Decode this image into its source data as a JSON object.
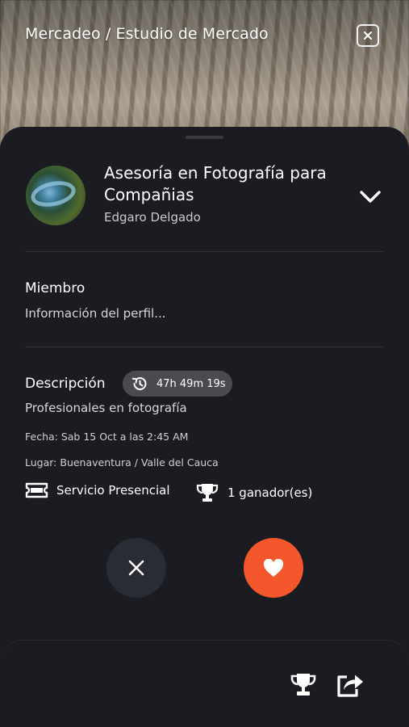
{
  "header": {
    "title": "Mercadeo / Estudio de Mercado",
    "close_icon": "close-icon"
  },
  "event": {
    "title": "Asesoría en Fotografía para Compañias",
    "owner": "Edgaro Delgado",
    "expand_icon": "chevron-down-icon"
  },
  "member": {
    "heading": "Miembro",
    "text": "Información del perfil..."
  },
  "description": {
    "heading": "Descripción",
    "timer": "47h 49m 19s",
    "timer_icon": "history-icon",
    "text": "Profesionales en fotografía",
    "date": "Fecha: Sab 15 Oct a las 2:45 AM",
    "place": "Lugar: Buenaventura / Valle del Cauca"
  },
  "tags": {
    "service": "Servicio Presencial",
    "service_icon": "ticket-icon",
    "winners": "1 ganador(es)",
    "winners_icon": "trophy-icon"
  },
  "actions": {
    "reject_icon": "close-icon",
    "like_icon": "heart-icon"
  },
  "bottom_bar": {
    "trophy_icon": "trophy-icon",
    "share_icon": "share-icon"
  },
  "colors": {
    "background": "#1b1c22",
    "accent": "#f4572b",
    "pill": "#4a4b50",
    "reject_button": "#2a2c35"
  }
}
